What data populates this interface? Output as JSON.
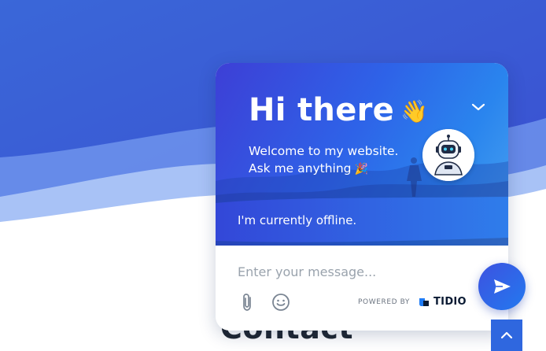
{
  "background": {
    "heading": "Contact",
    "colors": {
      "wave_dark": "#3b5fd6",
      "wave_light": "#8fb0f3"
    }
  },
  "widget": {
    "header": {
      "greeting": "Hi there",
      "greeting_emoji": "👋",
      "welcome_line1": "Welcome to my website.",
      "welcome_line2": "Ask me anything",
      "welcome_emoji": "🎉",
      "collapse_icon": "chevron-down-icon",
      "avatar_icon": "robot-icon"
    },
    "status": {
      "text": "I'm currently offline."
    },
    "composer": {
      "placeholder": "Enter your message...",
      "attach_icon": "paperclip-icon",
      "emoji_icon": "smiley-icon"
    },
    "branding": {
      "label": "POWERED BY",
      "brand": "TIDIO"
    },
    "colors": {
      "accent": "#2e63e8",
      "gradient_start": "#3d3fd6",
      "gradient_end": "#4aa3f0"
    }
  },
  "send_button": {
    "icon": "send-icon"
  },
  "scroll_top_button": {
    "icon": "chevron-up-icon"
  }
}
